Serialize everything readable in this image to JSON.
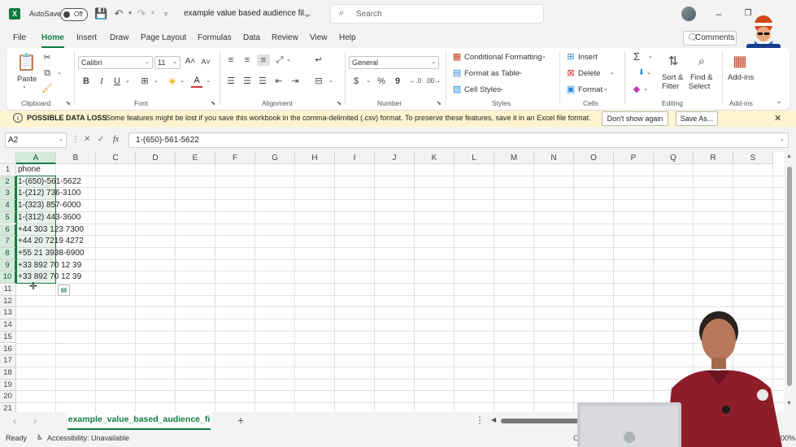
{
  "title_bar": {
    "autosave_label": "AutoSave",
    "autosave_state": "Off",
    "document_title": "example value based audience fil...",
    "search_placeholder": "Search"
  },
  "menu": {
    "tabs": [
      "File",
      "Home",
      "Insert",
      "Draw",
      "Page Layout",
      "Formulas",
      "Data",
      "Review",
      "View",
      "Help"
    ],
    "active_tab": "Home",
    "comments_label": "Comments"
  },
  "ribbon": {
    "clipboard": {
      "paste_label": "Paste",
      "group_label": "Clipboard"
    },
    "font": {
      "font_name": "Calibri",
      "font_size": "11",
      "bold": "B",
      "italic": "I",
      "underline": "U",
      "group_label": "Font"
    },
    "alignment": {
      "group_label": "Alignment"
    },
    "number": {
      "format": "General",
      "currency": "$",
      "percent": "%",
      "comma": "9",
      "group_label": "Number"
    },
    "styles": {
      "conditional_formatting": "Conditional Formatting",
      "format_as_table": "Format as Table",
      "cell_styles": "Cell Styles",
      "group_label": "Styles"
    },
    "cells": {
      "insert": "Insert",
      "delete": "Delete",
      "format": "Format",
      "group_label": "Cells"
    },
    "editing": {
      "sum": "Σ",
      "sort_filter_line1": "Sort &",
      "sort_filter_line2": "Filter",
      "find_select_line1": "Find &",
      "find_select_line2": "Select",
      "group_label": "Editing"
    },
    "addins": {
      "addins_label": "Add-ins",
      "group_label": "Add-ins"
    }
  },
  "info_bar": {
    "title": "POSSIBLE DATA LOSS",
    "message": "Some features might be lost if you save this workbook in the comma-delimited (.csv) format. To preserve these features, save it in an Excel file format.",
    "dont_show_label": "Don't show again",
    "save_as_label": "Save As..."
  },
  "formula_bar": {
    "name_box": "A2",
    "fx_label": "fx",
    "formula": "1-(650)-561-5622"
  },
  "grid": {
    "columns": [
      "A",
      "B",
      "C",
      "D",
      "E",
      "F",
      "G",
      "H",
      "I",
      "J",
      "K",
      "L",
      "M",
      "N",
      "O",
      "P",
      "Q",
      "R",
      "S"
    ],
    "rows": [
      "1",
      "2",
      "3",
      "4",
      "5",
      "6",
      "7",
      "8",
      "9",
      "10",
      "11",
      "12",
      "13",
      "14",
      "15",
      "16",
      "17",
      "18",
      "19",
      "20",
      "21"
    ],
    "selected_column": "A",
    "cells": [
      "phone",
      "1-(650)-561-5622",
      "1-(212) 736-3100",
      "1-(323) 857-6000",
      "1-(312) 443-3600",
      "+44 303 123 7300",
      "+44 20 7219 4272",
      "+55 21 3938-6900",
      "+33 892 70 12 39",
      "+33 892 70 12 39"
    ]
  },
  "sheets": {
    "active_sheet": "example_value_based_audience_fi",
    "add_sheet": "+"
  },
  "status_bar": {
    "ready": "Ready",
    "accessibility": "Accessibility: Unavailable",
    "count_partial": "Co",
    "zoom": "100%"
  },
  "colors": {
    "accent": "#107c41",
    "info_bar_bg": "#fff4ce",
    "selection_fill": "#d3e9d9"
  }
}
